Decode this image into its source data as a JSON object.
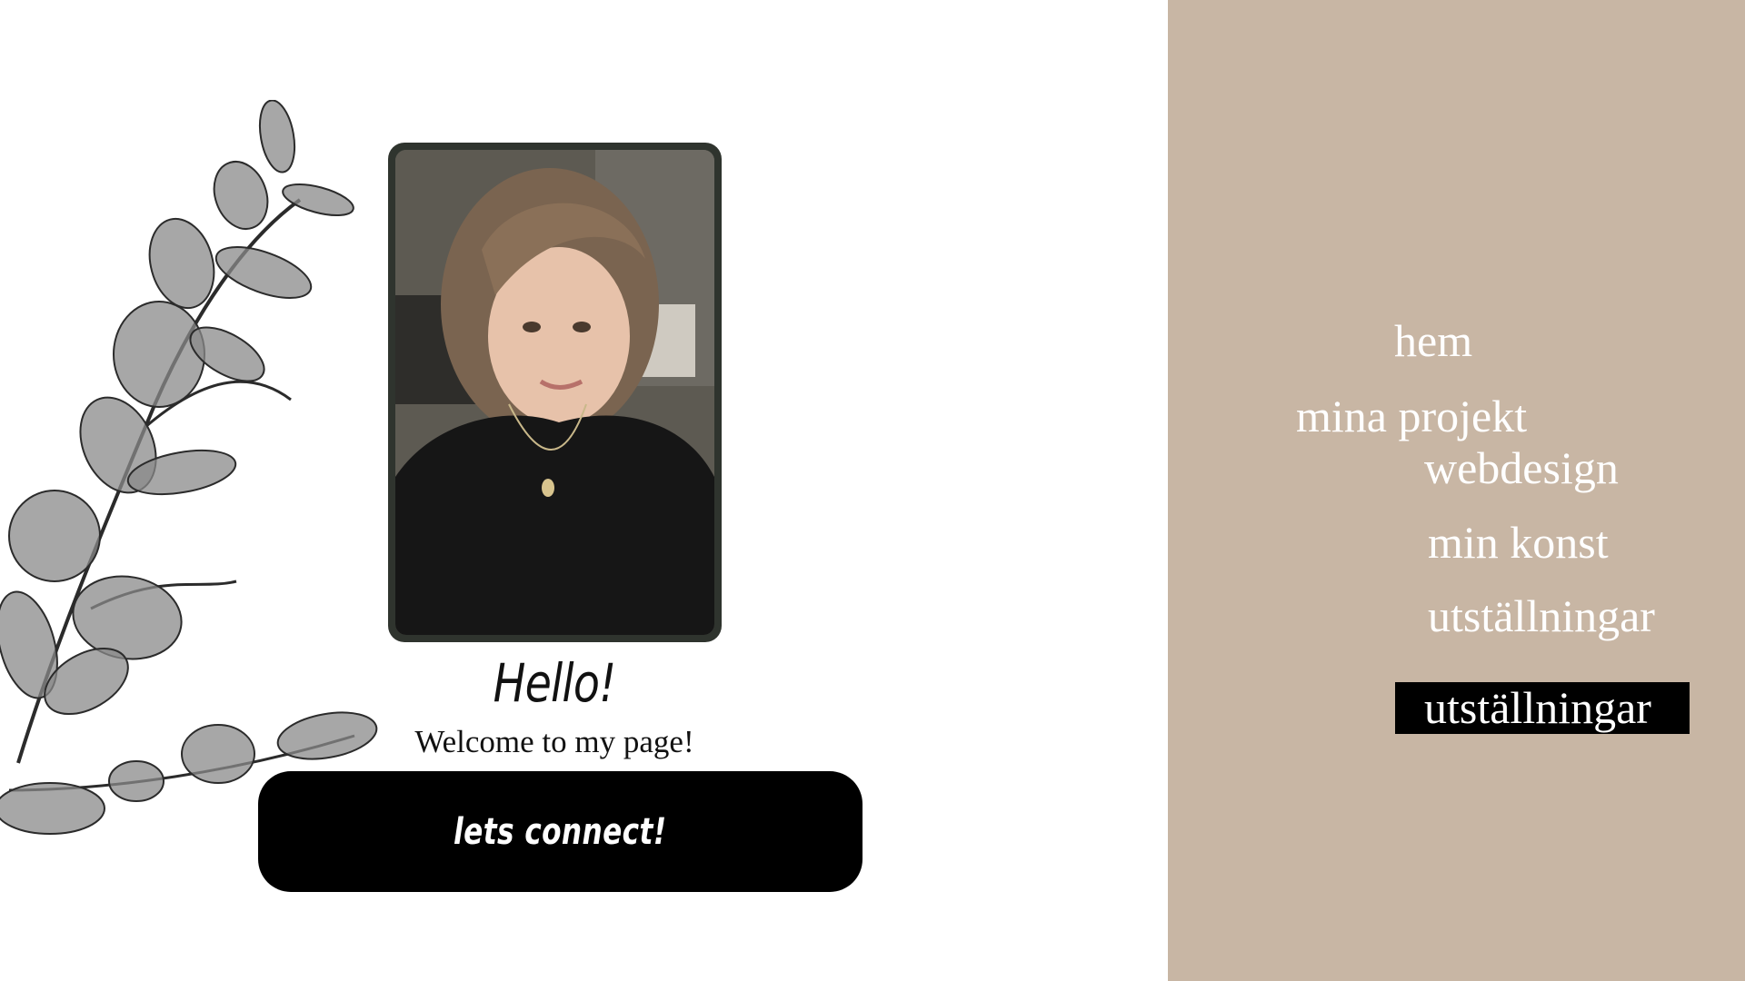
{
  "hero": {
    "greeting": "Hello!",
    "welcome": "Welcome to my page!",
    "cta_label": "lets connect!"
  },
  "nav": {
    "items": [
      {
        "label": "hem"
      },
      {
        "label": "mina projekt"
      },
      {
        "label": "webdesign"
      },
      {
        "label": "min konst"
      },
      {
        "label": "utställningar"
      }
    ],
    "active_label": "utställningar"
  },
  "colors": {
    "panel": "#c8b6a4",
    "button": "#000000",
    "nav_text": "#ffffff"
  },
  "icons": {
    "decoration": "eucalyptus-branch-illustration",
    "portrait": "profile-photo"
  }
}
